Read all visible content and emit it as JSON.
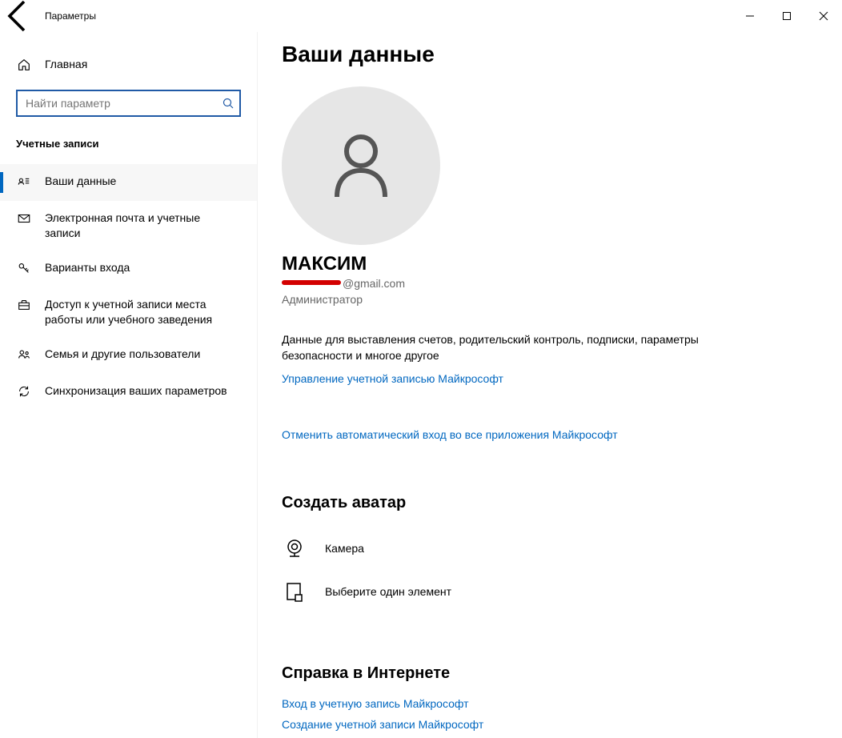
{
  "window": {
    "title": "Параметры"
  },
  "sidebar": {
    "home": "Главная",
    "search_placeholder": "Найти параметр",
    "section_label": "Учетные записи",
    "items": [
      {
        "label": "Ваши данные"
      },
      {
        "label": "Электронная почта и учетные записи"
      },
      {
        "label": "Варианты входа"
      },
      {
        "label": "Доступ к учетной записи места работы или учебного заведения"
      },
      {
        "label": "Семья и другие пользователи"
      },
      {
        "label": "Синхронизация ваших параметров"
      }
    ]
  },
  "main": {
    "title": "Ваши данные",
    "username": "МАКСИМ",
    "email_visible_part": "@gmail.com",
    "role": "Администратор",
    "billing_text": "Данные для выставления счетов, родительский контроль, подписки, параметры безопасности и многое другое",
    "manage_link": "Управление учетной записью Майкрософт",
    "signout_link": "Отменить автоматический вход во все приложения Майкрософт",
    "avatar_section_title": "Создать аватар",
    "camera_label": "Камера",
    "browse_label": "Выберите один элемент",
    "help_section_title": "Справка в Интернете",
    "help_signin": "Вход в учетную запись Майкрософт",
    "help_create": "Создание учетной записи Майкрософт"
  }
}
